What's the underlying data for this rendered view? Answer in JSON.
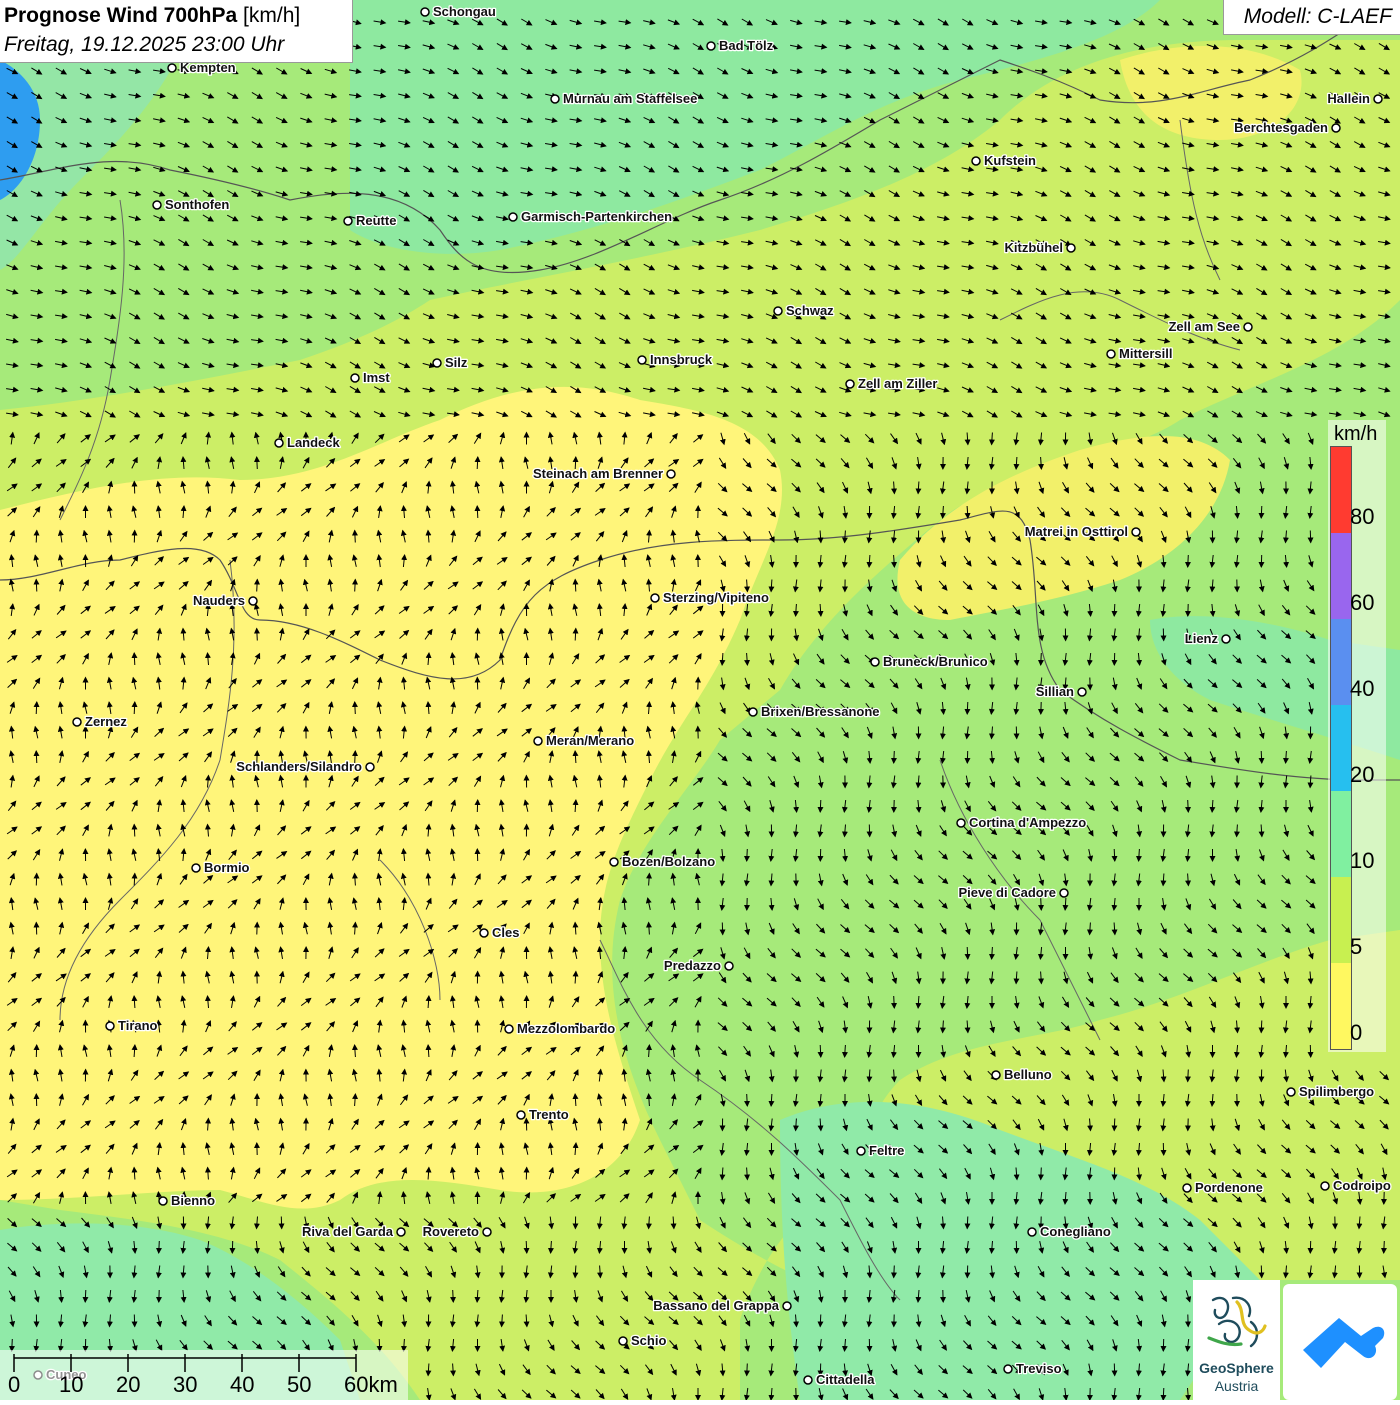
{
  "header": {
    "title_bold": "Prognose Wind 700hPa",
    "title_unit": "[km/h]",
    "datetime": "Freitag, 19.12.2025 23:00 Uhr",
    "model": "Modell: C-LAEF"
  },
  "legend": {
    "unit": "km/h",
    "labels": [
      "80",
      "60",
      "40",
      "20",
      "10",
      "5",
      "0"
    ],
    "colors": [
      "#ff3b30",
      "#9966ee",
      "#5a8ff0",
      "#26bfef",
      "#80f0a0",
      "#c8f050",
      "#fff860"
    ]
  },
  "scalebar": {
    "labels": [
      "0",
      "10",
      "20",
      "30",
      "40",
      "50",
      "60km"
    ]
  },
  "logo": {
    "name_line1": "GeoSphere",
    "name_line2": "Austria",
    "icon_2": "cloud-arrow-icon"
  },
  "cities": [
    {
      "name": "Schongau"
    },
    {
      "name": "Bad Tölz"
    },
    {
      "name": "Kempten"
    },
    {
      "name": "Murnau am Staffelsee"
    },
    {
      "name": "Hallein"
    },
    {
      "name": "Berchtesgaden"
    },
    {
      "name": "Kufstein"
    },
    {
      "name": "Sonthofen"
    },
    {
      "name": "Reutte"
    },
    {
      "name": "Garmisch-Partenkirchen"
    },
    {
      "name": "Kitzbühel"
    },
    {
      "name": "Schwaz"
    },
    {
      "name": "Zell am See"
    },
    {
      "name": "Mittersill"
    },
    {
      "name": "Innsbruck"
    },
    {
      "name": "Silz"
    },
    {
      "name": "Imst"
    },
    {
      "name": "Zell am Ziller"
    },
    {
      "name": "Landeck"
    },
    {
      "name": "Steinach am Brenner"
    },
    {
      "name": "Matrei in Osttirol"
    },
    {
      "name": "Nauders"
    },
    {
      "name": "Sterzing/Vipiteno"
    },
    {
      "name": "Lienz"
    },
    {
      "name": "Bruneck/Brunico"
    },
    {
      "name": "Sillian"
    },
    {
      "name": "Brixen/Bressanone"
    },
    {
      "name": "Zernez"
    },
    {
      "name": "Meran/Merano"
    },
    {
      "name": "Schlanders/Silandro"
    },
    {
      "name": "Cortina d'Ampezzo"
    },
    {
      "name": "Bozen/Bolzano"
    },
    {
      "name": "Bormio"
    },
    {
      "name": "Pieve di Cadore"
    },
    {
      "name": "Cles"
    },
    {
      "name": "Predazzo"
    },
    {
      "name": "Tirano"
    },
    {
      "name": "Mezzolombardo"
    },
    {
      "name": "Belluno"
    },
    {
      "name": "Spilimbergo"
    },
    {
      "name": "Trento"
    },
    {
      "name": "Feltre"
    },
    {
      "name": "Pordenone"
    },
    {
      "name": "Codroipo"
    },
    {
      "name": "Bienno"
    },
    {
      "name": "Riva del Garda"
    },
    {
      "name": "Rovereto"
    },
    {
      "name": "Conegliano"
    },
    {
      "name": "Bassano del Grappa"
    },
    {
      "name": "Schio"
    },
    {
      "name": "Treviso"
    },
    {
      "name": "Cittadella"
    },
    {
      "name": "Cuneo"
    }
  ]
}
